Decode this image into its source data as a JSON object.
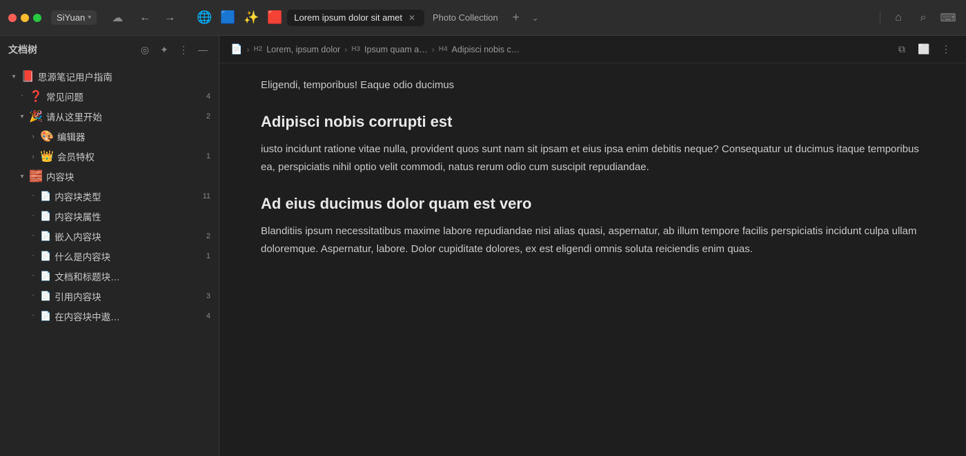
{
  "titlebar": {
    "app_name": "SiYuan",
    "chevron": "▾",
    "cloud_icon": "☁",
    "back_icon": "←",
    "forward_icon": "→",
    "tabs": [
      {
        "id": "tab1",
        "icon": "🌐",
        "label": null,
        "active": false,
        "closeable": false
      },
      {
        "id": "tab2",
        "icon": "🟦",
        "label": null,
        "active": false,
        "closeable": false
      },
      {
        "id": "tab3",
        "icon": "✨",
        "label": null,
        "active": false,
        "closeable": false
      },
      {
        "id": "tab4",
        "icon": "🟥",
        "label": null,
        "active": false,
        "closeable": false
      },
      {
        "id": "tab5",
        "icon": null,
        "label": "Lorem ipsum dolor sit amet",
        "active": true,
        "closeable": true
      },
      {
        "id": "tab6",
        "icon": null,
        "label": "Photo Collection",
        "active": false,
        "closeable": false
      }
    ],
    "add_tab_label": "+",
    "tab_list_icon": "⌄",
    "right_icons": [
      "⌂",
      "⌕",
      "⌨"
    ]
  },
  "sidebar": {
    "title": "文档树",
    "actions": [
      "◎",
      "✦",
      "⋮",
      "—"
    ],
    "tree": [
      {
        "id": "item1",
        "level": 0,
        "toggle": "▾",
        "bullet": null,
        "icon": "📕",
        "label": "思源笔记用户指南",
        "count": null
      },
      {
        "id": "item2",
        "level": 1,
        "toggle": null,
        "bullet": "•",
        "icon": "❓",
        "label": "常见问题",
        "count": "4"
      },
      {
        "id": "item3",
        "level": 1,
        "toggle": "▾",
        "bullet": null,
        "icon": "🎉",
        "label": "请从这里开始",
        "count": "2"
      },
      {
        "id": "item4",
        "level": 2,
        "toggle": "›",
        "bullet": null,
        "icon": "🎨",
        "label": "编辑器",
        "count": null
      },
      {
        "id": "item5",
        "level": 2,
        "toggle": "›",
        "bullet": null,
        "icon": "👑",
        "label": "会员特权",
        "count": "1"
      },
      {
        "id": "item6",
        "level": 1,
        "toggle": "▾",
        "bullet": null,
        "icon": "🧱",
        "label": "内容块",
        "count": null
      },
      {
        "id": "item7",
        "level": 2,
        "toggle": null,
        "bullet": "•",
        "icon": "doc",
        "label": "内容块类型",
        "count": "11"
      },
      {
        "id": "item8",
        "level": 2,
        "toggle": null,
        "bullet": "•",
        "icon": "doc",
        "label": "内容块属性",
        "count": null
      },
      {
        "id": "item9",
        "level": 2,
        "toggle": null,
        "bullet": "•",
        "icon": "doc",
        "label": "嵌入内容块",
        "count": "2"
      },
      {
        "id": "item10",
        "level": 2,
        "toggle": null,
        "bullet": "•",
        "icon": "doc",
        "label": "什么是内容块",
        "count": "1"
      },
      {
        "id": "item11",
        "level": 2,
        "toggle": null,
        "bullet": "•",
        "icon": "doc",
        "label": "文档和标题块…",
        "count": null
      },
      {
        "id": "item12",
        "level": 2,
        "toggle": null,
        "bullet": "•",
        "icon": "doc",
        "label": "引用内容块",
        "count": "3"
      },
      {
        "id": "item13",
        "level": 2,
        "toggle": null,
        "bullet": "•",
        "icon": "doc",
        "label": "在内容块中遨…",
        "count": "4"
      }
    ]
  },
  "breadcrumb": {
    "doc_icon": "📄",
    "items": [
      {
        "level": "H2",
        "label": "Lorem, ipsum dolor"
      },
      {
        "level": "H3",
        "label": "Ipsum quam a…"
      },
      {
        "level": "H4",
        "label": "Adipisci nobis c…"
      }
    ],
    "right_icons": [
      "⧉",
      "⬜",
      "⋮"
    ]
  },
  "content": {
    "intro_text": "Eligendi, temporibus! Eaque odio ducimus",
    "section1": {
      "heading": "Adipisci nobis corrupti est",
      "paragraph": "iusto incidunt ratione vitae nulla, provident quos sunt nam sit ipsam et eius ipsa enim debitis neque? Consequatur ut ducimus itaque temporibus ea, perspiciatis nihil optio velit commodi, natus rerum odio cum suscipit repudiandae."
    },
    "section2": {
      "heading": "Ad eius ducimus dolor quam est vero",
      "paragraph": "Blanditiis ipsum necessitatibus maxime labore repudiandae nisi alias quasi, aspernatur, ab illum tempore facilis perspiciatis incidunt culpa ullam doloremque. Aspernatur, labore. Dolor cupiditate dolores, ex est eligendi omnis soluta reiciendis enim quas."
    }
  }
}
